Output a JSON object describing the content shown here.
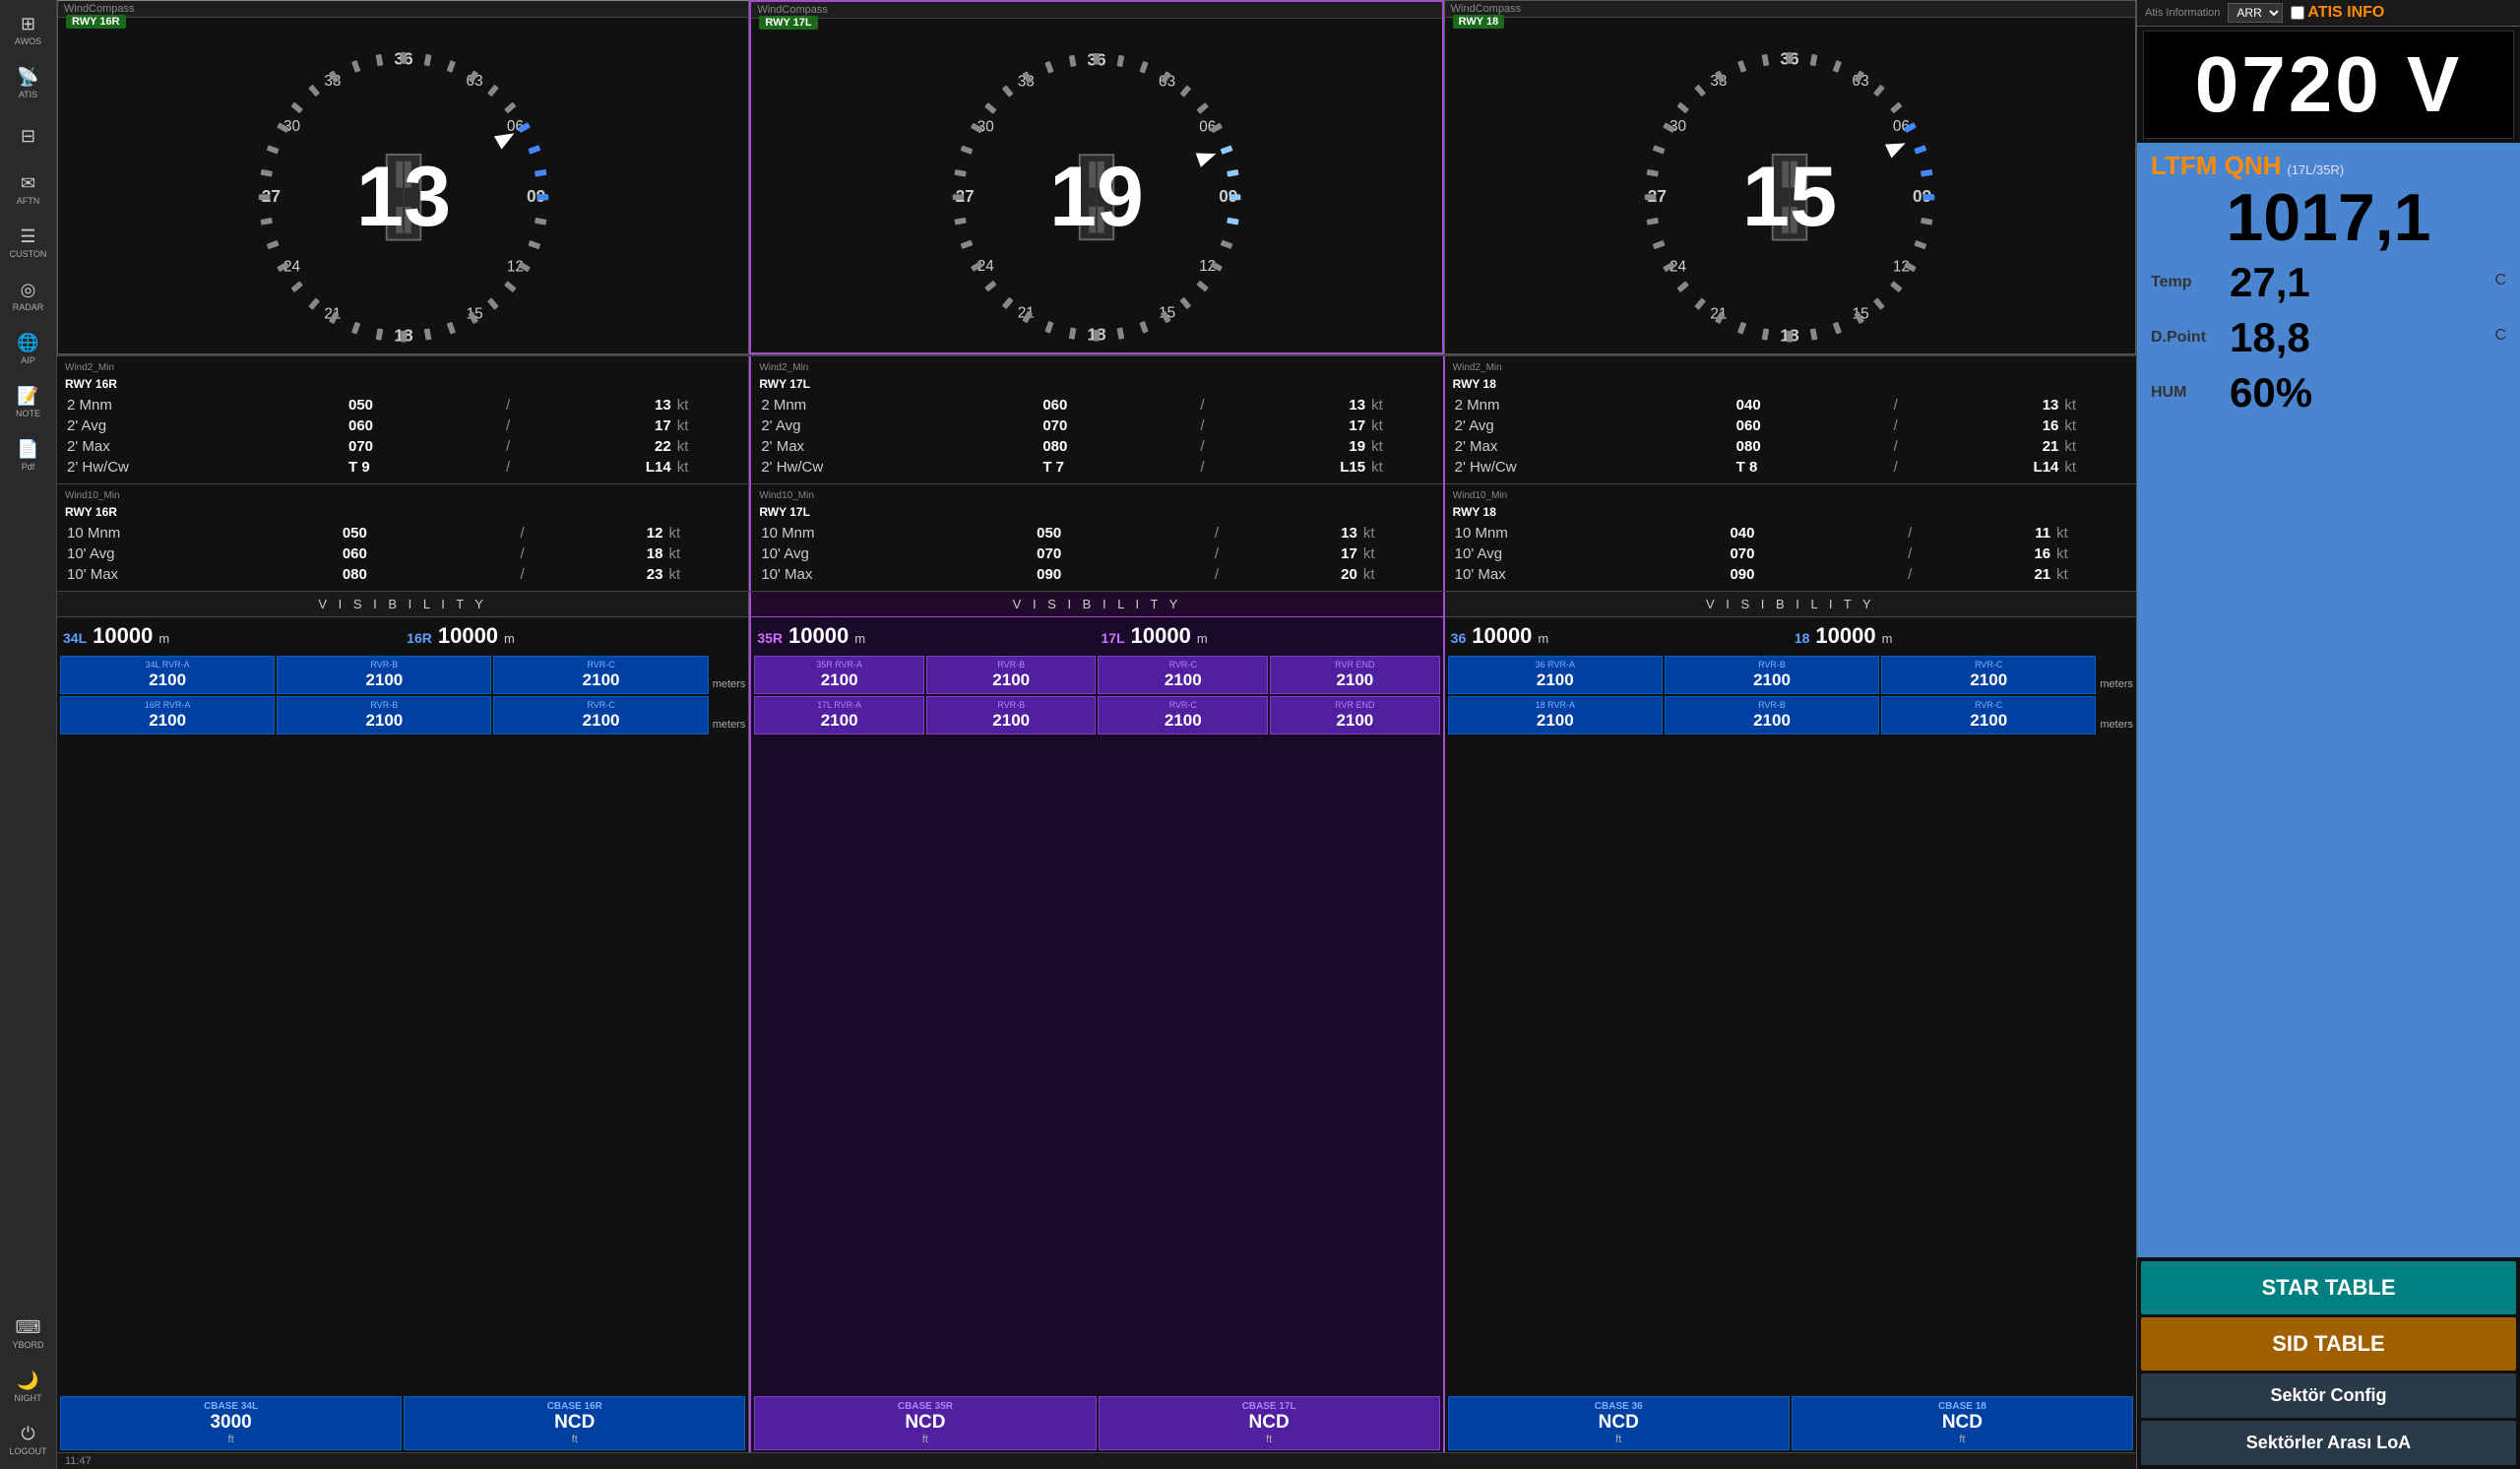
{
  "sidebar": {
    "items": [
      {
        "id": "awos",
        "label": "AWOS",
        "icon": "⊞"
      },
      {
        "id": "atis",
        "label": "ATIS",
        "icon": "📡"
      },
      {
        "id": "icon3",
        "label": "",
        "icon": "⊟"
      },
      {
        "id": "aftn",
        "label": "AFTN",
        "icon": "✉"
      },
      {
        "id": "custom",
        "label": "CUSTON",
        "icon": "☰"
      },
      {
        "id": "radar",
        "label": "RADAR",
        "icon": "◎"
      },
      {
        "id": "aip",
        "label": "AIP",
        "icon": "🌐"
      },
      {
        "id": "note",
        "label": "NOTE",
        "icon": "📝"
      },
      {
        "id": "pdf",
        "label": "Pdf",
        "icon": "📄"
      },
      {
        "id": "yboard",
        "label": "YBORD",
        "icon": "⌨"
      },
      {
        "id": "night",
        "label": "NIGHT",
        "icon": "🌙"
      },
      {
        "id": "logout",
        "label": "LOGOUT",
        "icon": "⏻"
      }
    ]
  },
  "compasses": [
    {
      "id": "compass1",
      "title": "WindCompass",
      "rwy": "RWY 16R",
      "wind_speed": "13",
      "border_color": "normal"
    },
    {
      "id": "compass2",
      "title": "WindCompass",
      "rwy": "RWY 17L",
      "wind_speed": "19",
      "border_color": "purple"
    },
    {
      "id": "compass3",
      "title": "WindCompass",
      "rwy": "RWY 18",
      "wind_speed": "15",
      "border_color": "normal"
    }
  ],
  "compass_labels": {
    "top": "36",
    "top_right": "03",
    "right": "09",
    "bottom_right": "15",
    "bottom": "18",
    "bottom_left": "21",
    "left": "27",
    "top_left": "33",
    "right_upper": "06",
    "left_lower": "24",
    "right_lower": "12",
    "left_upper": "30"
  },
  "wind2_data": [
    {
      "rwy": "RWY 16R",
      "rows": [
        {
          "label": "2 Mnm",
          "dir": "050",
          "speed": "13",
          "unit": "kt"
        },
        {
          "label": "2' Avg",
          "dir": "060",
          "speed": "17",
          "unit": "kt"
        },
        {
          "label": "2' Max",
          "dir": "070",
          "speed": "22",
          "unit": "kt"
        },
        {
          "label": "2' Hw/Cw",
          "dir": "T 9",
          "speed": "L14",
          "unit": "kt"
        }
      ]
    },
    {
      "rwy": "RWY 17L",
      "rows": [
        {
          "label": "2 Mnm",
          "dir": "060",
          "speed": "13",
          "unit": "kt"
        },
        {
          "label": "2' Avg",
          "dir": "070",
          "speed": "17",
          "unit": "kt"
        },
        {
          "label": "2' Max",
          "dir": "080",
          "speed": "19",
          "unit": "kt"
        },
        {
          "label": "2' Hw/Cw",
          "dir": "T 7",
          "speed": "L15",
          "unit": "kt"
        }
      ]
    },
    {
      "rwy": "RWY 18",
      "rows": [
        {
          "label": "2 Mnm",
          "dir": "040",
          "speed": "13",
          "unit": "kt"
        },
        {
          "label": "2' Avg",
          "dir": "060",
          "speed": "16",
          "unit": "kt"
        },
        {
          "label": "2' Max",
          "dir": "080",
          "speed": "21",
          "unit": "kt"
        },
        {
          "label": "2' Hw/Cw",
          "dir": "T 8",
          "speed": "L14",
          "unit": "kt"
        }
      ]
    }
  ],
  "wind10_data": [
    {
      "rwy": "RWY 16R",
      "rows": [
        {
          "label": "10 Mnm",
          "dir": "050",
          "speed": "12",
          "unit": "kt"
        },
        {
          "label": "10' Avg",
          "dir": "060",
          "speed": "18",
          "unit": "kt"
        },
        {
          "label": "10' Max",
          "dir": "080",
          "speed": "23",
          "unit": "kt"
        }
      ]
    },
    {
      "rwy": "RWY 17L",
      "rows": [
        {
          "label": "10 Mnm",
          "dir": "050",
          "speed": "13",
          "unit": "kt"
        },
        {
          "label": "10' Avg",
          "dir": "070",
          "speed": "17",
          "unit": "kt"
        },
        {
          "label": "10' Max",
          "dir": "090",
          "speed": "20",
          "unit": "kt"
        }
      ]
    },
    {
      "rwy": "RWY 18",
      "rows": [
        {
          "label": "10 Mnm",
          "dir": "040",
          "speed": "11",
          "unit": "kt"
        },
        {
          "label": "10' Avg",
          "dir": "070",
          "speed": "16",
          "unit": "kt"
        },
        {
          "label": "10' Max",
          "dir": "090",
          "speed": "21",
          "unit": "kt"
        }
      ]
    }
  ],
  "visibility": [
    {
      "id": "vis1",
      "title": "V I S I B I L I T Y",
      "border": "normal",
      "runways": [
        {
          "label": "34L",
          "value": "10000",
          "unit": "m",
          "color": "blue"
        },
        {
          "label": "16R",
          "value": "10000",
          "unit": "m",
          "color": "blue"
        }
      ],
      "rvr_rows": [
        {
          "rwy": "34L",
          "cells": [
            {
              "label": "RVR-A",
              "value": "2100"
            },
            {
              "label": "RVR-B",
              "value": "2100"
            },
            {
              "label": "RVR-C",
              "value": "2100"
            }
          ],
          "unit": "meters"
        },
        {
          "rwy": "16R",
          "cells": [
            {
              "label": "RVR-A",
              "value": "2100"
            },
            {
              "label": "RVR-B",
              "value": "2100"
            },
            {
              "label": "RVR-C",
              "value": "2100"
            }
          ],
          "unit": "meters"
        }
      ],
      "cbase": [
        {
          "label": "CBASE 34L",
          "value": "3000",
          "unit": "ft"
        },
        {
          "label": "CBASE 16R",
          "value": "NCD",
          "unit": "ft"
        }
      ]
    },
    {
      "id": "vis2",
      "title": "V I S I B I L I T Y",
      "border": "purple",
      "runways": [
        {
          "label": "35R",
          "value": "10000",
          "unit": "m",
          "color": "purple"
        },
        {
          "label": "17L",
          "value": "10000",
          "unit": "m",
          "color": "purple"
        }
      ],
      "rvr_rows": [
        {
          "rwy": "35R",
          "cells": [
            {
              "label": "RVR-A",
              "value": "2100"
            },
            {
              "label": "RVR-B",
              "value": "2100"
            },
            {
              "label": "RVR-C",
              "value": "2100"
            },
            {
              "label": "RVR END",
              "value": "2100"
            }
          ],
          "unit": null
        },
        {
          "rwy": "17L",
          "cells": [
            {
              "label": "RVR-A",
              "value": "2100"
            },
            {
              "label": "RVR-B",
              "value": "2100"
            },
            {
              "label": "RVR-C",
              "value": "2100"
            },
            {
              "label": "RVR END",
              "value": "2100"
            }
          ],
          "unit": null
        }
      ],
      "cbase": [
        {
          "label": "CBASE 35R",
          "value": "NCD",
          "unit": "ft"
        },
        {
          "label": "CBASE 17L",
          "value": "NCD",
          "unit": "ft"
        }
      ]
    },
    {
      "id": "vis3",
      "title": "V I S I B I L I T Y",
      "border": "normal",
      "runways": [
        {
          "label": "36",
          "value": "10000",
          "unit": "m",
          "color": "blue"
        },
        {
          "label": "18",
          "value": "10000",
          "unit": "m",
          "color": "blue"
        }
      ],
      "rvr_rows": [
        {
          "rwy": "36",
          "cells": [
            {
              "label": "RVR-A",
              "value": "2100"
            },
            {
              "label": "RVR-B",
              "value": "2100"
            },
            {
              "label": "RVR-C",
              "value": "2100"
            }
          ],
          "unit": "meters"
        },
        {
          "rwy": "18",
          "cells": [
            {
              "label": "RVR-A",
              "value": "2100"
            },
            {
              "label": "RVR-B",
              "value": "2100"
            },
            {
              "label": "RVR-C",
              "value": "2100"
            }
          ],
          "unit": "meters"
        }
      ],
      "cbase": [
        {
          "label": "CBASE 36",
          "value": "NCD",
          "unit": "ft"
        },
        {
          "label": "CBASE 18",
          "value": "NCD",
          "unit": "ft"
        }
      ]
    }
  ],
  "atis": {
    "panel_title": "Atis Information",
    "arr_label": "ARR",
    "checkbox_label": "ATIS INFO",
    "info_value": "0720 V",
    "qnh_label": "LTFM QNH",
    "qnh_sub": "(17L/35R)",
    "qnh_value": "1017,1",
    "temp_label": "Temp",
    "temp_value": "27,1",
    "temp_unit": "C",
    "dpoint_label": "D.Point",
    "dpoint_value": "18,8",
    "dpoint_unit": "C",
    "hum_label": "HUM",
    "hum_value": "60%"
  },
  "buttons": {
    "star_table": "STAR TABLE",
    "sid_table": "SID TABLE",
    "sektor_config": "Sektör Config",
    "sektorler_arasi": "Sektörler Arası LoA"
  },
  "status_bar": {
    "time": "11:47"
  }
}
